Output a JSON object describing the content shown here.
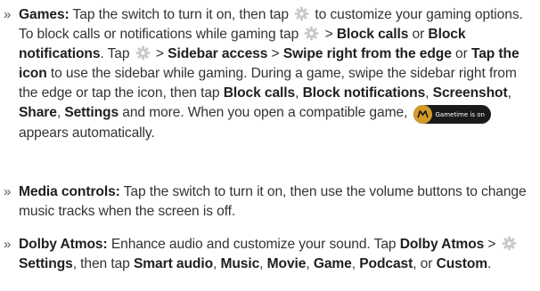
{
  "bullet_glyph": "»",
  "games": {
    "label": "Games:",
    "t1": " Tap the switch to turn it on, then tap ",
    "t2": " to customize your gaming options. To block calls or notifications while gaming tap ",
    "t3": " > ",
    "b_block_calls": "Block calls",
    "t4": " or ",
    "b_block_notifications": "Block notifications",
    "t5": ". Tap ",
    "t6": " > ",
    "b_sidebar_access": "Sidebar access",
    "t7": " > ",
    "b_swipe_right": "Swipe right from the edge",
    "t8": " or ",
    "b_tap_icon": "Tap the icon",
    "t9": " to use the sidebar while gaming. During a game, swipe the sidebar right from the edge or tap the icon, then tap ",
    "b_block_calls_2": "Block calls",
    "t10": ", ",
    "b_block_notifications_2": "Block notifications",
    "t11": ", ",
    "b_screenshot": "Screenshot",
    "t12": ", ",
    "b_share": "Share",
    "t13": ", ",
    "b_settings": "Settings",
    "t14": " and more. When you open a compatible game, ",
    "badge_text": "Gametime is on",
    "t15": " appears automatically."
  },
  "media": {
    "label": "Media controls:",
    "t1": " Tap the switch to turn it on, then use the volume buttons to change music tracks when the screen is off."
  },
  "dolby": {
    "label": "Dolby Atmos:",
    "t1": " Enhance audio and customize your sound. Tap ",
    "b_dolby_atmos": "Dolby Atmos",
    "t2": " > ",
    "b_settings": "Settings",
    "t3": ", then tap ",
    "b_smart_audio": "Smart audio",
    "t4": ", ",
    "b_music": "Music",
    "t5": ", ",
    "b_movie": "Movie",
    "t6": ", ",
    "b_game": "Game",
    "t7": ", ",
    "b_podcast": "Podcast",
    "t8": ", or ",
    "b_custom": "Custom",
    "t9": "."
  },
  "icons": {
    "gear": "gear-icon",
    "badge_logo": "moto-logo-icon"
  },
  "colors": {
    "text": "#333333",
    "bold": "#1f1f1f",
    "gear": "#c9c9c9",
    "badge_bg": "#1a1a1a",
    "badge_logo": "#d39a2a"
  }
}
